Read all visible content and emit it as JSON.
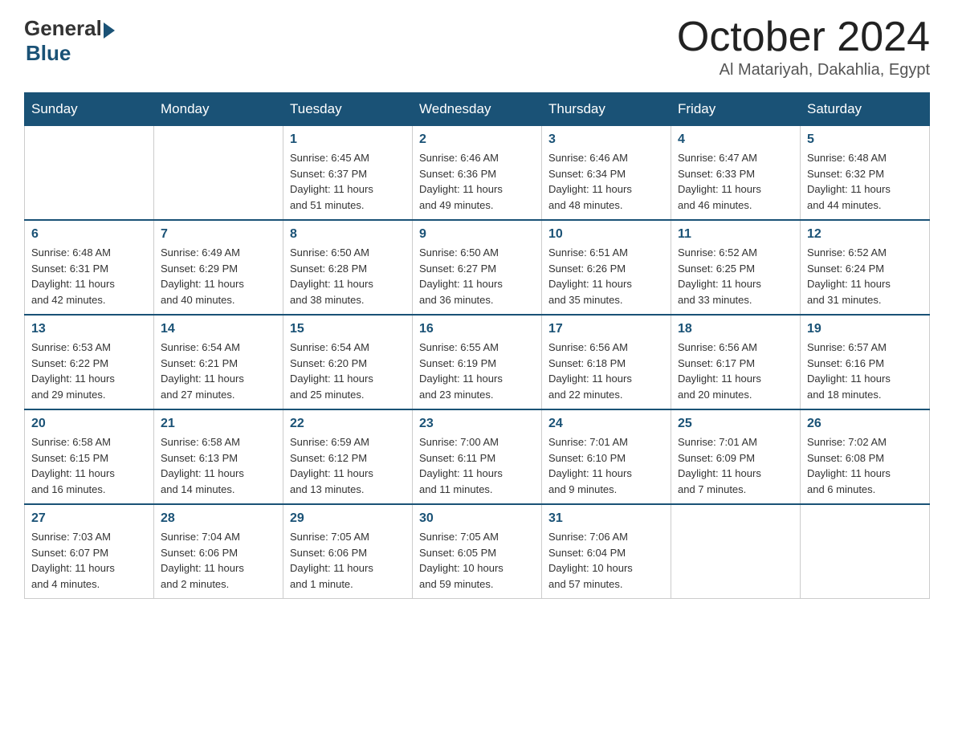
{
  "header": {
    "logo": {
      "general": "General",
      "blue": "Blue"
    },
    "title": "October 2024",
    "location": "Al Matariyah, Dakahlia, Egypt"
  },
  "days_of_week": [
    "Sunday",
    "Monday",
    "Tuesday",
    "Wednesday",
    "Thursday",
    "Friday",
    "Saturday"
  ],
  "weeks": [
    [
      {
        "day": "",
        "info": ""
      },
      {
        "day": "",
        "info": ""
      },
      {
        "day": "1",
        "info": "Sunrise: 6:45 AM\nSunset: 6:37 PM\nDaylight: 11 hours\nand 51 minutes."
      },
      {
        "day": "2",
        "info": "Sunrise: 6:46 AM\nSunset: 6:36 PM\nDaylight: 11 hours\nand 49 minutes."
      },
      {
        "day": "3",
        "info": "Sunrise: 6:46 AM\nSunset: 6:34 PM\nDaylight: 11 hours\nand 48 minutes."
      },
      {
        "day": "4",
        "info": "Sunrise: 6:47 AM\nSunset: 6:33 PM\nDaylight: 11 hours\nand 46 minutes."
      },
      {
        "day": "5",
        "info": "Sunrise: 6:48 AM\nSunset: 6:32 PM\nDaylight: 11 hours\nand 44 minutes."
      }
    ],
    [
      {
        "day": "6",
        "info": "Sunrise: 6:48 AM\nSunset: 6:31 PM\nDaylight: 11 hours\nand 42 minutes."
      },
      {
        "day": "7",
        "info": "Sunrise: 6:49 AM\nSunset: 6:29 PM\nDaylight: 11 hours\nand 40 minutes."
      },
      {
        "day": "8",
        "info": "Sunrise: 6:50 AM\nSunset: 6:28 PM\nDaylight: 11 hours\nand 38 minutes."
      },
      {
        "day": "9",
        "info": "Sunrise: 6:50 AM\nSunset: 6:27 PM\nDaylight: 11 hours\nand 36 minutes."
      },
      {
        "day": "10",
        "info": "Sunrise: 6:51 AM\nSunset: 6:26 PM\nDaylight: 11 hours\nand 35 minutes."
      },
      {
        "day": "11",
        "info": "Sunrise: 6:52 AM\nSunset: 6:25 PM\nDaylight: 11 hours\nand 33 minutes."
      },
      {
        "day": "12",
        "info": "Sunrise: 6:52 AM\nSunset: 6:24 PM\nDaylight: 11 hours\nand 31 minutes."
      }
    ],
    [
      {
        "day": "13",
        "info": "Sunrise: 6:53 AM\nSunset: 6:22 PM\nDaylight: 11 hours\nand 29 minutes."
      },
      {
        "day": "14",
        "info": "Sunrise: 6:54 AM\nSunset: 6:21 PM\nDaylight: 11 hours\nand 27 minutes."
      },
      {
        "day": "15",
        "info": "Sunrise: 6:54 AM\nSunset: 6:20 PM\nDaylight: 11 hours\nand 25 minutes."
      },
      {
        "day": "16",
        "info": "Sunrise: 6:55 AM\nSunset: 6:19 PM\nDaylight: 11 hours\nand 23 minutes."
      },
      {
        "day": "17",
        "info": "Sunrise: 6:56 AM\nSunset: 6:18 PM\nDaylight: 11 hours\nand 22 minutes."
      },
      {
        "day": "18",
        "info": "Sunrise: 6:56 AM\nSunset: 6:17 PM\nDaylight: 11 hours\nand 20 minutes."
      },
      {
        "day": "19",
        "info": "Sunrise: 6:57 AM\nSunset: 6:16 PM\nDaylight: 11 hours\nand 18 minutes."
      }
    ],
    [
      {
        "day": "20",
        "info": "Sunrise: 6:58 AM\nSunset: 6:15 PM\nDaylight: 11 hours\nand 16 minutes."
      },
      {
        "day": "21",
        "info": "Sunrise: 6:58 AM\nSunset: 6:13 PM\nDaylight: 11 hours\nand 14 minutes."
      },
      {
        "day": "22",
        "info": "Sunrise: 6:59 AM\nSunset: 6:12 PM\nDaylight: 11 hours\nand 13 minutes."
      },
      {
        "day": "23",
        "info": "Sunrise: 7:00 AM\nSunset: 6:11 PM\nDaylight: 11 hours\nand 11 minutes."
      },
      {
        "day": "24",
        "info": "Sunrise: 7:01 AM\nSunset: 6:10 PM\nDaylight: 11 hours\nand 9 minutes."
      },
      {
        "day": "25",
        "info": "Sunrise: 7:01 AM\nSunset: 6:09 PM\nDaylight: 11 hours\nand 7 minutes."
      },
      {
        "day": "26",
        "info": "Sunrise: 7:02 AM\nSunset: 6:08 PM\nDaylight: 11 hours\nand 6 minutes."
      }
    ],
    [
      {
        "day": "27",
        "info": "Sunrise: 7:03 AM\nSunset: 6:07 PM\nDaylight: 11 hours\nand 4 minutes."
      },
      {
        "day": "28",
        "info": "Sunrise: 7:04 AM\nSunset: 6:06 PM\nDaylight: 11 hours\nand 2 minutes."
      },
      {
        "day": "29",
        "info": "Sunrise: 7:05 AM\nSunset: 6:06 PM\nDaylight: 11 hours\nand 1 minute."
      },
      {
        "day": "30",
        "info": "Sunrise: 7:05 AM\nSunset: 6:05 PM\nDaylight: 10 hours\nand 59 minutes."
      },
      {
        "day": "31",
        "info": "Sunrise: 7:06 AM\nSunset: 6:04 PM\nDaylight: 10 hours\nand 57 minutes."
      },
      {
        "day": "",
        "info": ""
      },
      {
        "day": "",
        "info": ""
      }
    ]
  ]
}
